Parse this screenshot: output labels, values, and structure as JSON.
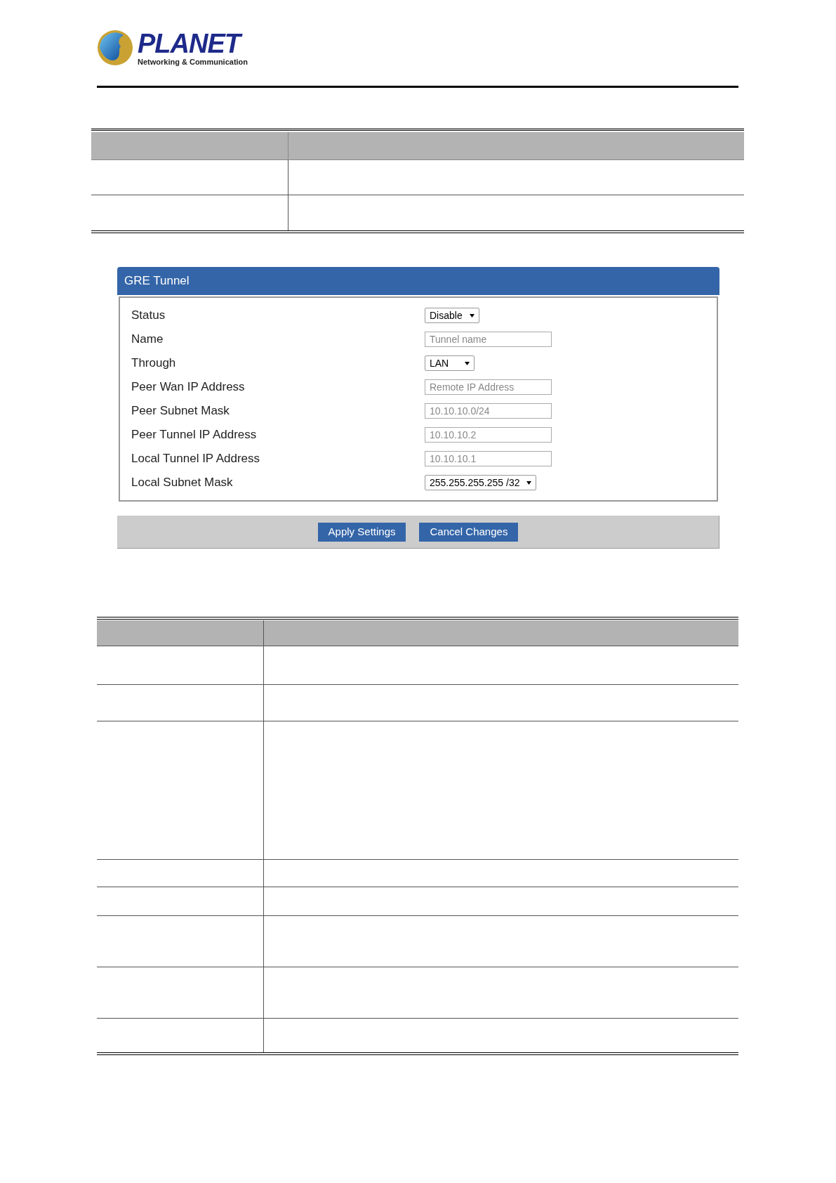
{
  "logo": {
    "brand": "PLANET",
    "tagline": "Networking & Communication"
  },
  "panel": {
    "title": "GRE Tunnel",
    "fields": [
      {
        "label": "Status",
        "kind": "select",
        "value": "Disable"
      },
      {
        "label": "Name",
        "kind": "input",
        "placeholder": "Tunnel name"
      },
      {
        "label": "Through",
        "kind": "select",
        "value": "LAN"
      },
      {
        "label": "Peer Wan IP Address",
        "kind": "input",
        "placeholder": "Remote IP Address"
      },
      {
        "label": "Peer Subnet Mask",
        "kind": "input",
        "placeholder": "10.10.10.0/24"
      },
      {
        "label": "Peer Tunnel IP Address",
        "kind": "input",
        "placeholder": "10.10.10.2"
      },
      {
        "label": "Local Tunnel IP Address",
        "kind": "input",
        "placeholder": "10.10.10.1"
      },
      {
        "label": "Local Subnet Mask",
        "kind": "select",
        "value": "255.255.255.255 /32"
      }
    ],
    "buttons": [
      "Apply Settings",
      "Cancel Changes"
    ]
  }
}
